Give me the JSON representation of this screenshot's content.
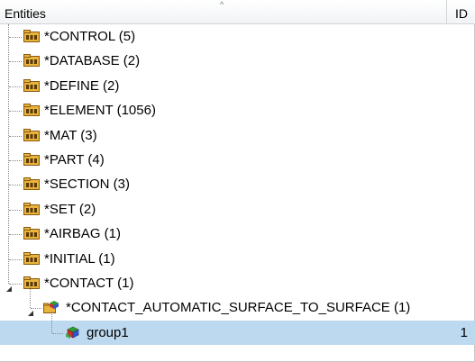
{
  "header": {
    "entities_label": "Entities",
    "id_label": "ID",
    "sort_indicator": "^"
  },
  "tree": {
    "items": [
      {
        "label": "*CONTROL (5)",
        "level": 0,
        "icon": "keyword-folder-icon"
      },
      {
        "label": "*DATABASE (2)",
        "level": 0,
        "icon": "keyword-folder-icon"
      },
      {
        "label": "*DEFINE (2)",
        "level": 0,
        "icon": "keyword-folder-icon"
      },
      {
        "label": "*ELEMENT (1056)",
        "level": 0,
        "icon": "keyword-folder-icon"
      },
      {
        "label": "*MAT (3)",
        "level": 0,
        "icon": "keyword-folder-icon"
      },
      {
        "label": "*PART (4)",
        "level": 0,
        "icon": "keyword-folder-icon"
      },
      {
        "label": "*SECTION (3)",
        "level": 0,
        "icon": "keyword-folder-icon"
      },
      {
        "label": "*SET (2)",
        "level": 0,
        "icon": "keyword-folder-icon"
      },
      {
        "label": "*AIRBAG (1)",
        "level": 0,
        "icon": "keyword-folder-icon"
      },
      {
        "label": "*INITIAL (1)",
        "level": 0,
        "icon": "keyword-folder-icon"
      },
      {
        "label": "*CONTACT (1)",
        "level": 0,
        "icon": "keyword-folder-icon",
        "expanded": true
      },
      {
        "label": "*CONTACT_AUTOMATIC_SURFACE_TO_SURFACE (1)",
        "level": 1,
        "icon": "contact-group-folder-icon",
        "expanded": true
      },
      {
        "label": "group1",
        "level": 2,
        "icon": "contact-group-icon",
        "id": "1",
        "selected": true
      }
    ]
  },
  "colors": {
    "selection": "#bdd9ef",
    "folder_fill": "#e8b43a",
    "header_bg": "#f1f3f5"
  }
}
